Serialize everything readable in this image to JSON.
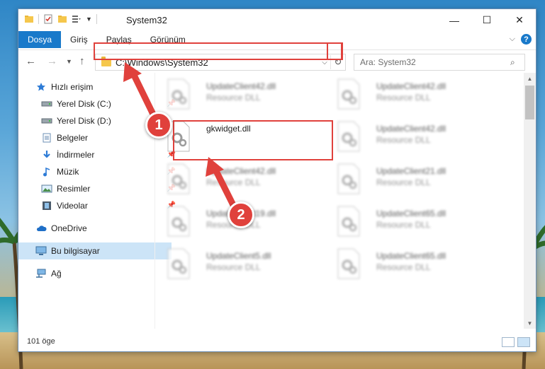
{
  "window": {
    "title": "System32",
    "controls": {
      "minimize": "—",
      "maximize": "☐",
      "close": "✕"
    }
  },
  "ribbon": {
    "tabs": [
      {
        "label": "Dosya",
        "active": true
      },
      {
        "label": "Giriş"
      },
      {
        "label": "Paylaş"
      },
      {
        "label": "Görünüm"
      }
    ],
    "help": "?"
  },
  "nav": {
    "address": "C:\\Windows\\System32",
    "search_placeholder": "Ara: System32"
  },
  "sidebar": {
    "items": [
      {
        "label": "Hızlı erişim",
        "icon": "star-icon"
      },
      {
        "label": "Yerel Disk (C:)",
        "icon": "drive-icon"
      },
      {
        "label": "Yerel Disk (D:)",
        "icon": "drive-icon"
      },
      {
        "label": "Belgeler",
        "icon": "document-icon"
      },
      {
        "label": "İndirmeler",
        "icon": "download-icon"
      },
      {
        "label": "Müzik",
        "icon": "music-icon"
      },
      {
        "label": "Resimler",
        "icon": "picture-icon"
      },
      {
        "label": "Videolar",
        "icon": "video-icon"
      },
      {
        "label": "OneDrive",
        "icon": "cloud-icon"
      },
      {
        "label": "Bu bilgisayar",
        "icon": "computer-icon"
      },
      {
        "label": "Ağ",
        "icon": "network-icon"
      }
    ]
  },
  "files": [
    {
      "name": "UpdateClient42.dll",
      "type": "Resource DLL"
    },
    {
      "name": "UpdateClient42.dll",
      "type": "Resource DLL"
    },
    {
      "name": "gkwidget.dll",
      "type": ""
    },
    {
      "name": "UpdateClient42.dll",
      "type": "Resource DLL"
    },
    {
      "name": "UpdateClient42.dll",
      "type": "Resource DLL"
    },
    {
      "name": "UpdateClient21.dll",
      "type": "Resource DLL"
    },
    {
      "name": "UpdateClient19.dll",
      "type": "Resource DLL"
    },
    {
      "name": "UpdateClient65.dll",
      "type": "Resource DLL"
    },
    {
      "name": "UpdateClient5.dll",
      "type": "Resource DLL"
    },
    {
      "name": "UpdateClient65.dll",
      "type": "Resource DLL"
    }
  ],
  "status": {
    "count": "101 öge"
  },
  "callouts": {
    "one": "1",
    "two": "2"
  },
  "colors": {
    "accent": "#1979ca",
    "highlight": "#e0413c",
    "selection": "#cce4f7"
  }
}
